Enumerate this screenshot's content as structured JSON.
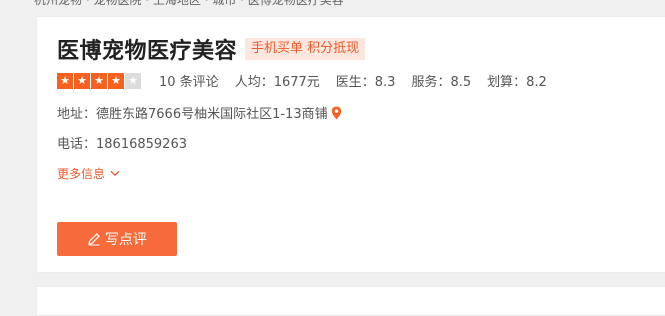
{
  "breadcrumb": {
    "text": "杭州宠物 · 宠物医院 · 上海地区 · 城市 · 医博宠物医疗美容"
  },
  "shop": {
    "name": "医博宠物医疗美容",
    "promo_badge": "手机买单 积分抵现",
    "rating": {
      "stars_filled": 4,
      "stars_total": 5
    },
    "review_count": "10 条评论",
    "avg_price": "人均：1677元",
    "doctor_score": "医生：8.3",
    "service_score": "服务：8.5",
    "value_score": "划算：8.2",
    "address": "地址：德胜东路7666号柚米国际社区1-13商铺",
    "phone": "电话：18616859263",
    "more_info": "更多信息",
    "write_review": "写点评"
  },
  "colors": {
    "accent": "#f76a3a",
    "star": "#f76120",
    "badge_bg": "#fde6de"
  },
  "icons": [
    "star-icon",
    "location-pin-icon",
    "chevron-down-icon",
    "pen-icon"
  ]
}
